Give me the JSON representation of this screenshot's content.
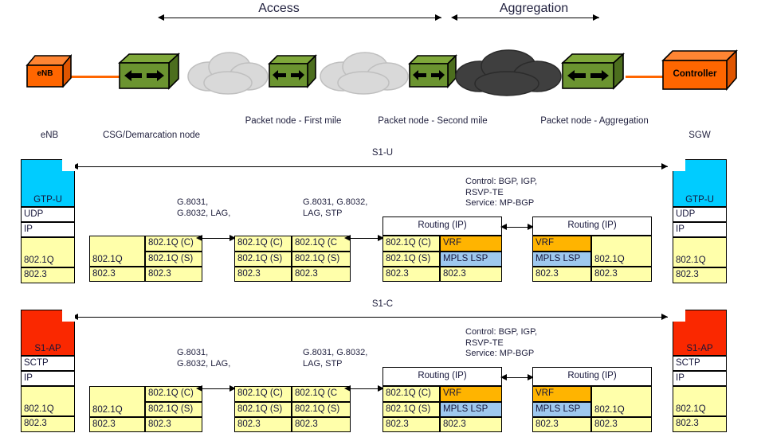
{
  "header": {
    "access_label": "Access",
    "aggregation_label": "Aggregation"
  },
  "topology": {
    "devices": [
      {
        "name": "enb-device",
        "label": "eNB",
        "type": "box-orange"
      },
      {
        "name": "csg-router",
        "label": "",
        "type": "router"
      },
      {
        "name": "first-mile-cloud",
        "label": "",
        "type": "cloud-light"
      },
      {
        "name": "first-mile-router",
        "label": "",
        "type": "router"
      },
      {
        "name": "second-mile-cloud",
        "label": "",
        "type": "cloud-light"
      },
      {
        "name": "second-mile-router",
        "label": "",
        "type": "router"
      },
      {
        "name": "aggregation-cloud",
        "label": "",
        "type": "cloud-dark"
      },
      {
        "name": "aggregation-router",
        "label": "",
        "type": "router"
      },
      {
        "name": "controller-device",
        "label": "Controller",
        "type": "box-orange"
      }
    ],
    "node_labels": [
      "eNB",
      "CSG/Demarcation node",
      "Packet node - First mile",
      "Packet node - Second mile",
      "Packet node - Aggregation",
      "SGW"
    ]
  },
  "planes": [
    {
      "key": "s1u",
      "span_label": "S1-U",
      "annotations": [
        "G.8031,\nG.8032, LAG,",
        "G.8031, G.8032,\nLAG, STP",
        "Control: BGP, IGP,\nRSVP-TE\nService: MP-BGP"
      ],
      "annot_1_l1": "G.8031,",
      "annot_1_l2": "G.8032, LAG,",
      "annot_2_l1": "G.8031, G.8032,",
      "annot_2_l2": "LAG, STP",
      "annot_3_l1": "Control: BGP, IGP,",
      "annot_3_l2": "RSVP-TE",
      "annot_3_l3": "Service: MP-BGP",
      "endpoint_top": "GTP-U",
      "endpoint_transport": "UDP",
      "endpoint_net": "IP",
      "endpoint_vlan": "802.1Q",
      "endpoint_mac": "802.3",
      "stack2": {
        "left_vlan": "802.1Q",
        "left_mac": "802.3",
        "right_c": "802.1Q (C)",
        "right_s": "802.1Q (S)",
        "right_mac": "802.3"
      },
      "stack3": {
        "left_c": "802.1Q (C)",
        "left_s": "802.1Q (S)",
        "left_mac": "802.3",
        "right_c": "802.1Q (C",
        "right_s": "802.1Q (S)",
        "right_mac": "802.3"
      },
      "stack4": {
        "routing": "Routing (IP)",
        "left_c": "802.1Q (C)",
        "left_s": "802.1Q (S)",
        "left_mac": "802.3",
        "right_vrf": "VRF",
        "right_mpls": "MPLS LSP",
        "right_mac": "802.3"
      },
      "stack5": {
        "routing": "Routing (IP)",
        "left_vrf": "VRF",
        "left_mpls": "MPLS LSP",
        "left_mac": "802.3",
        "right_vlan": "802.1Q",
        "right_mac": "802.3"
      }
    },
    {
      "key": "s1c",
      "span_label": "S1-C",
      "annot_1_l1": "G.8031,",
      "annot_1_l2": "G.8032, LAG,",
      "annot_2_l1": "G.8031, G.8032,",
      "annot_2_l2": "LAG, STP",
      "annot_3_l1": "Control: BGP, IGP,",
      "annot_3_l2": "RSVP-TE",
      "annot_3_l3": "Service: MP-BGP",
      "endpoint_top": "S1-AP",
      "endpoint_transport": "SCTP",
      "endpoint_net": "IP",
      "endpoint_vlan": "802.1Q",
      "endpoint_mac": "802.3",
      "stack2": {
        "left_vlan": "802.1Q",
        "left_mac": "802.3",
        "right_c": "802.1Q (C)",
        "right_s": "802.1Q (S)",
        "right_mac": "802.3"
      },
      "stack3": {
        "left_c": "802.1Q (C)",
        "left_s": "802.1Q (S)",
        "left_mac": "802.3",
        "right_c": "802.1Q (C",
        "right_s": "802.1Q (S)",
        "right_mac": "802.3"
      },
      "stack4": {
        "routing": "Routing (IP)",
        "left_c": "802.1Q (C)",
        "left_s": "802.1Q (S)",
        "left_mac": "802.3",
        "right_vrf": "VRF",
        "right_mpls": "MPLS LSP",
        "right_mac": "802.3"
      },
      "stack5": {
        "routing": "Routing (IP)",
        "left_vrf": "VRF",
        "left_mpls": "MPLS LSP",
        "left_mac": "802.3",
        "right_vlan": "802.1Q",
        "right_mac": "802.3"
      }
    }
  ],
  "colors": {
    "orange_device": "#FF6600",
    "router_green": "#5F8A28",
    "cloud_light": "#D9D9D9",
    "cloud_dark": "#3F3F3F",
    "gtpu_cyan": "#00CCFF",
    "s1ap_red": "#FA2800",
    "vlan_yellow": "#FFFFAA",
    "vrf_amber": "#FFB400",
    "mpls_blue": "#9EC8EE",
    "link_orange": "#FF6600"
  }
}
